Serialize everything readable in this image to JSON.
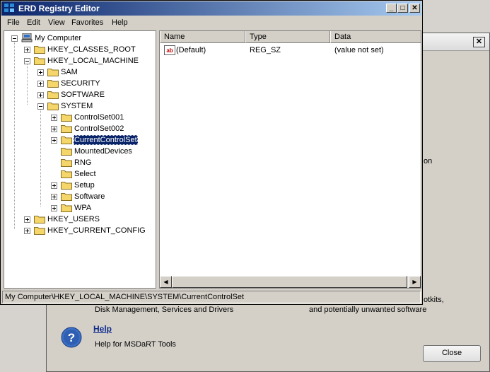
{
  "window": {
    "title": "ERD Registry Editor",
    "minimize_label": "_",
    "maximize_label": "□",
    "close_label": "✕"
  },
  "menu": [
    "File",
    "Edit",
    "View",
    "Favorites",
    "Help"
  ],
  "tree": {
    "root": "My Computer",
    "nodes": [
      {
        "label": "HKEY_CLASSES_ROOT"
      },
      {
        "label": "HKEY_LOCAL_MACHINE"
      },
      {
        "label": "SAM"
      },
      {
        "label": "SECURITY"
      },
      {
        "label": "SOFTWARE"
      },
      {
        "label": "SYSTEM"
      },
      {
        "label": "ControlSet001"
      },
      {
        "label": "ControlSet002"
      },
      {
        "label": "CurrentControlSet"
      },
      {
        "label": "MountedDevices"
      },
      {
        "label": "RNG"
      },
      {
        "label": "Select"
      },
      {
        "label": "Setup"
      },
      {
        "label": "Software"
      },
      {
        "label": "WPA"
      },
      {
        "label": "HKEY_USERS"
      },
      {
        "label": "HKEY_CURRENT_CONFIG"
      }
    ]
  },
  "list": {
    "columns": [
      "Name",
      "Type",
      "Data"
    ],
    "rows": [
      {
        "name": "(Default)",
        "type": "REG_SZ",
        "data": "(value not set)"
      }
    ]
  },
  "statusbar": "My Computer\\HKEY_LOCAL_MACHINE\\SYSTEM\\CurrentControlSet",
  "background": {
    "frag_on": "on",
    "frag_otkits": "otkits,",
    "frag_disk": "Disk Management, Services and Drivers",
    "frag_unwanted": "and potentially unwanted software",
    "help_title": "Help",
    "help_desc": "Help for MSDaRT Tools",
    "close_label": "Close",
    "close_icon_label": "✕"
  },
  "colors": {
    "titlebar_start": "#0a246a",
    "titlebar_end": "#a6caf0",
    "selection": "#0a246a",
    "folder": "#f5d66b"
  }
}
